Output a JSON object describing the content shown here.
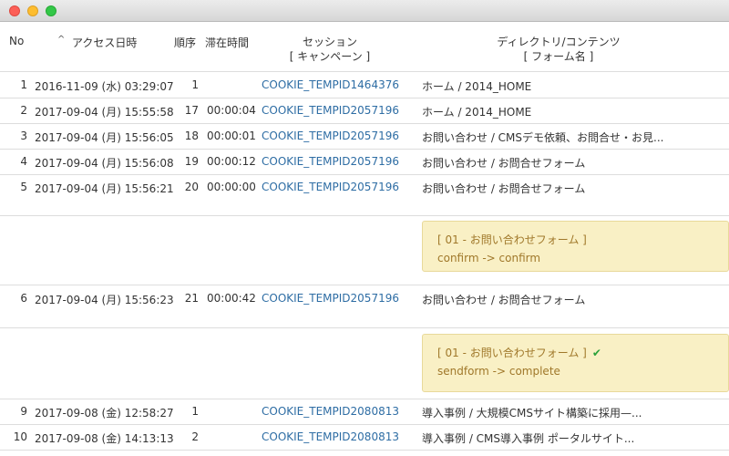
{
  "window": {
    "buttons": [
      "close",
      "minimize",
      "zoom"
    ]
  },
  "header": {
    "no": "No",
    "sort_indicator": "^",
    "access_time": "アクセス日時",
    "order": "順序",
    "dwell": "滞在時間",
    "session_line1": "セッション",
    "session_line2": "[ キャンペーン ]",
    "dir_line1": "ディレクトリ/コンテンツ",
    "dir_line2": "[ フォーム名 ]"
  },
  "rows": [
    {
      "no": "1",
      "date": "2016-11-09 (水) 03:29:07",
      "order": "1",
      "dwell": "",
      "session": "COOKIE_TEMPID1464376",
      "dir": "ホーム / 2014_HOME"
    },
    {
      "no": "2",
      "date": "2017-09-04 (月) 15:55:58",
      "order": "17",
      "dwell": "00:00:04",
      "session": "COOKIE_TEMPID2057196",
      "dir": "ホーム / 2014_HOME"
    },
    {
      "no": "3",
      "date": "2017-09-04 (月) 15:56:05",
      "order": "18",
      "dwell": "00:00:01",
      "session": "COOKIE_TEMPID2057196",
      "dir": "お問い合わせ / CMSデモ依頼、お問合せ・お見..."
    },
    {
      "no": "4",
      "date": "2017-09-04 (月) 15:56:08",
      "order": "19",
      "dwell": "00:00:12",
      "session": "COOKIE_TEMPID2057196",
      "dir": "お問い合わせ / お問合せフォーム"
    },
    {
      "no": "5",
      "date": "2017-09-04 (月) 15:56:21",
      "order": "20",
      "dwell": "00:00:00",
      "session": "COOKIE_TEMPID2057196",
      "dir": "お問い合わせ / お問合せフォーム"
    },
    {
      "no": "6",
      "date": "2017-09-04 (月) 15:56:23",
      "order": "21",
      "dwell": "00:00:42",
      "session": "COOKIE_TEMPID2057196",
      "dir": "お問い合わせ / お問合せフォーム"
    },
    {
      "no": "9",
      "date": "2017-09-08 (金) 12:58:27",
      "order": "1",
      "dwell": "",
      "session": "COOKIE_TEMPID2080813",
      "dir": "導入事例 / 大規模CMSサイト構築に採用—..."
    },
    {
      "no": "10",
      "date": "2017-09-08 (金) 14:13:13",
      "order": "2",
      "dwell": "",
      "session": "COOKIE_TEMPID2080813",
      "dir": "導入事例 / CMS導入事例 ポータルサイト..."
    }
  ],
  "notes": [
    {
      "form": "[ 01 - お問い合わせフォーム ]",
      "transition": "confirm -> confirm",
      "complete": false
    },
    {
      "form": "[ 01 - お問い合わせフォーム ]",
      "transition": "sendform -> complete",
      "complete": true
    }
  ]
}
